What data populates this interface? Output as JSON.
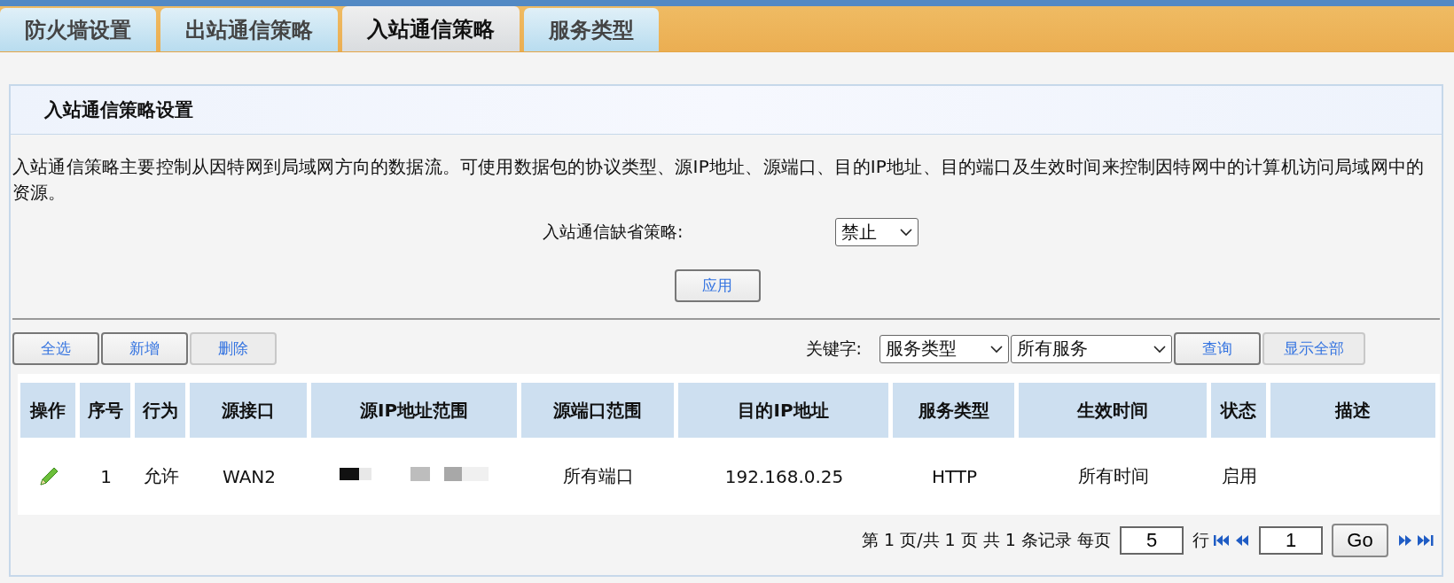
{
  "tabs": [
    {
      "label": "防火墙设置",
      "selected": false
    },
    {
      "label": "出站通信策略",
      "selected": false
    },
    {
      "label": "入站通信策略",
      "selected": true
    },
    {
      "label": "服务类型",
      "selected": false
    }
  ],
  "panel": {
    "title": "入站通信策略设置",
    "description": "入站通信策略主要控制从因特网到局域网方向的数据流。可使用数据包的协议类型、源IP地址、源端口、目的IP地址、目的端口及生效时间来控制因特网中的计算机访问局域网中的资源。",
    "default_policy": {
      "label": "入站通信缺省策略:",
      "value": "禁止"
    },
    "apply_button": "应用"
  },
  "toolbar": {
    "buttons": [
      {
        "label": "全选",
        "disabled": false
      },
      {
        "label": "新增",
        "disabled": false
      },
      {
        "label": "删除",
        "disabled": true
      }
    ],
    "keyword_label": "关键字:",
    "keyword_field": "服务类型",
    "keyword_value": "所有服务",
    "search_button": {
      "label": "查询",
      "disabled": false
    },
    "show_all_button": {
      "label": "显示全部",
      "disabled": true
    }
  },
  "table": {
    "columns": [
      "操作",
      "序号",
      "行为",
      "源接口",
      "源IP地址范围",
      "源端口范围",
      "目的IP地址",
      "服务类型",
      "生效时间",
      "状态",
      "描述"
    ],
    "rows": [
      {
        "index": "1",
        "action": "允许",
        "interface": "WAN2",
        "source_ip_redacted": true,
        "source_port": "所有端口",
        "dest_ip": "192.168.0.25",
        "service": "HTTP",
        "time": "所有时间",
        "status": "启用"
      }
    ]
  },
  "pagination": {
    "page_info": "第 1 页/共 1 页 共 1 条记录 每页",
    "page_size": "5",
    "rows_unit": "行",
    "page_number": "1",
    "go_button": "Go"
  }
}
